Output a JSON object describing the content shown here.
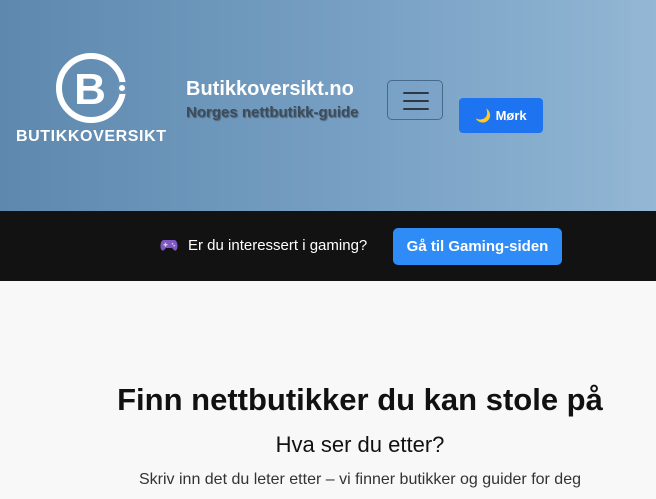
{
  "header": {
    "logo_letter": "B",
    "logo_text": "BUTIKKOVERSIKT",
    "site_title": "Butikkoversikt.no",
    "tagline": "Norges nettbutikk-guide",
    "menu_icon": "hamburger-icon",
    "dark_mode_icon": "moon-icon",
    "dark_mode_label": "Mørk"
  },
  "gaming_bar": {
    "icon": "gamepad-icon",
    "text": "Er du interessert i gaming?",
    "button_label": "Gå til Gaming-siden"
  },
  "main": {
    "title": "Finn nettbutikker du kan stole på",
    "subtitle": "Hva ser du etter?",
    "description": "Skriv inn det du leter etter – vi finner butikker og guider for deg"
  },
  "colors": {
    "header_gradient_start": "#5f88ae",
    "header_gradient_end": "#93b7d4",
    "primary_button": "#1e74f0",
    "gaming_button": "#2f8cf6",
    "gaming_bar_bg": "#121212"
  }
}
